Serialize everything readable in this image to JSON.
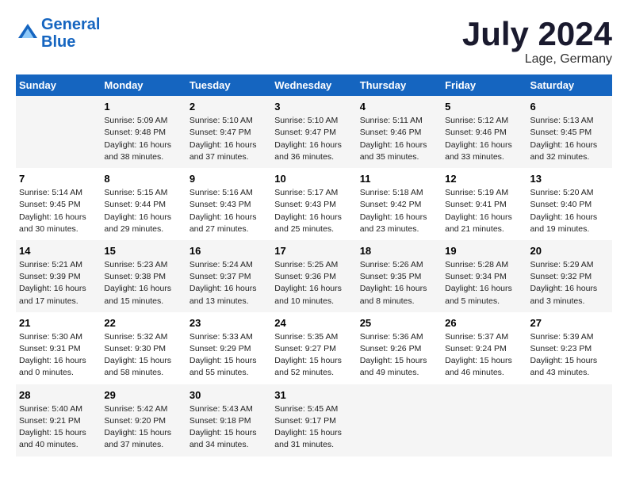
{
  "header": {
    "logo_line1": "General",
    "logo_line2": "Blue",
    "month": "July 2024",
    "location": "Lage, Germany"
  },
  "days_of_week": [
    "Sunday",
    "Monday",
    "Tuesday",
    "Wednesday",
    "Thursday",
    "Friday",
    "Saturday"
  ],
  "weeks": [
    [
      {
        "day": "",
        "info": ""
      },
      {
        "day": "1",
        "info": "Sunrise: 5:09 AM\nSunset: 9:48 PM\nDaylight: 16 hours\nand 38 minutes."
      },
      {
        "day": "2",
        "info": "Sunrise: 5:10 AM\nSunset: 9:47 PM\nDaylight: 16 hours\nand 37 minutes."
      },
      {
        "day": "3",
        "info": "Sunrise: 5:10 AM\nSunset: 9:47 PM\nDaylight: 16 hours\nand 36 minutes."
      },
      {
        "day": "4",
        "info": "Sunrise: 5:11 AM\nSunset: 9:46 PM\nDaylight: 16 hours\nand 35 minutes."
      },
      {
        "day": "5",
        "info": "Sunrise: 5:12 AM\nSunset: 9:46 PM\nDaylight: 16 hours\nand 33 minutes."
      },
      {
        "day": "6",
        "info": "Sunrise: 5:13 AM\nSunset: 9:45 PM\nDaylight: 16 hours\nand 32 minutes."
      }
    ],
    [
      {
        "day": "7",
        "info": "Sunrise: 5:14 AM\nSunset: 9:45 PM\nDaylight: 16 hours\nand 30 minutes."
      },
      {
        "day": "8",
        "info": "Sunrise: 5:15 AM\nSunset: 9:44 PM\nDaylight: 16 hours\nand 29 minutes."
      },
      {
        "day": "9",
        "info": "Sunrise: 5:16 AM\nSunset: 9:43 PM\nDaylight: 16 hours\nand 27 minutes."
      },
      {
        "day": "10",
        "info": "Sunrise: 5:17 AM\nSunset: 9:43 PM\nDaylight: 16 hours\nand 25 minutes."
      },
      {
        "day": "11",
        "info": "Sunrise: 5:18 AM\nSunset: 9:42 PM\nDaylight: 16 hours\nand 23 minutes."
      },
      {
        "day": "12",
        "info": "Sunrise: 5:19 AM\nSunset: 9:41 PM\nDaylight: 16 hours\nand 21 minutes."
      },
      {
        "day": "13",
        "info": "Sunrise: 5:20 AM\nSunset: 9:40 PM\nDaylight: 16 hours\nand 19 minutes."
      }
    ],
    [
      {
        "day": "14",
        "info": "Sunrise: 5:21 AM\nSunset: 9:39 PM\nDaylight: 16 hours\nand 17 minutes."
      },
      {
        "day": "15",
        "info": "Sunrise: 5:23 AM\nSunset: 9:38 PM\nDaylight: 16 hours\nand 15 minutes."
      },
      {
        "day": "16",
        "info": "Sunrise: 5:24 AM\nSunset: 9:37 PM\nDaylight: 16 hours\nand 13 minutes."
      },
      {
        "day": "17",
        "info": "Sunrise: 5:25 AM\nSunset: 9:36 PM\nDaylight: 16 hours\nand 10 minutes."
      },
      {
        "day": "18",
        "info": "Sunrise: 5:26 AM\nSunset: 9:35 PM\nDaylight: 16 hours\nand 8 minutes."
      },
      {
        "day": "19",
        "info": "Sunrise: 5:28 AM\nSunset: 9:34 PM\nDaylight: 16 hours\nand 5 minutes."
      },
      {
        "day": "20",
        "info": "Sunrise: 5:29 AM\nSunset: 9:32 PM\nDaylight: 16 hours\nand 3 minutes."
      }
    ],
    [
      {
        "day": "21",
        "info": "Sunrise: 5:30 AM\nSunset: 9:31 PM\nDaylight: 16 hours\nand 0 minutes."
      },
      {
        "day": "22",
        "info": "Sunrise: 5:32 AM\nSunset: 9:30 PM\nDaylight: 15 hours\nand 58 minutes."
      },
      {
        "day": "23",
        "info": "Sunrise: 5:33 AM\nSunset: 9:29 PM\nDaylight: 15 hours\nand 55 minutes."
      },
      {
        "day": "24",
        "info": "Sunrise: 5:35 AM\nSunset: 9:27 PM\nDaylight: 15 hours\nand 52 minutes."
      },
      {
        "day": "25",
        "info": "Sunrise: 5:36 AM\nSunset: 9:26 PM\nDaylight: 15 hours\nand 49 minutes."
      },
      {
        "day": "26",
        "info": "Sunrise: 5:37 AM\nSunset: 9:24 PM\nDaylight: 15 hours\nand 46 minutes."
      },
      {
        "day": "27",
        "info": "Sunrise: 5:39 AM\nSunset: 9:23 PM\nDaylight: 15 hours\nand 43 minutes."
      }
    ],
    [
      {
        "day": "28",
        "info": "Sunrise: 5:40 AM\nSunset: 9:21 PM\nDaylight: 15 hours\nand 40 minutes."
      },
      {
        "day": "29",
        "info": "Sunrise: 5:42 AM\nSunset: 9:20 PM\nDaylight: 15 hours\nand 37 minutes."
      },
      {
        "day": "30",
        "info": "Sunrise: 5:43 AM\nSunset: 9:18 PM\nDaylight: 15 hours\nand 34 minutes."
      },
      {
        "day": "31",
        "info": "Sunrise: 5:45 AM\nSunset: 9:17 PM\nDaylight: 15 hours\nand 31 minutes."
      },
      {
        "day": "",
        "info": ""
      },
      {
        "day": "",
        "info": ""
      },
      {
        "day": "",
        "info": ""
      }
    ]
  ]
}
